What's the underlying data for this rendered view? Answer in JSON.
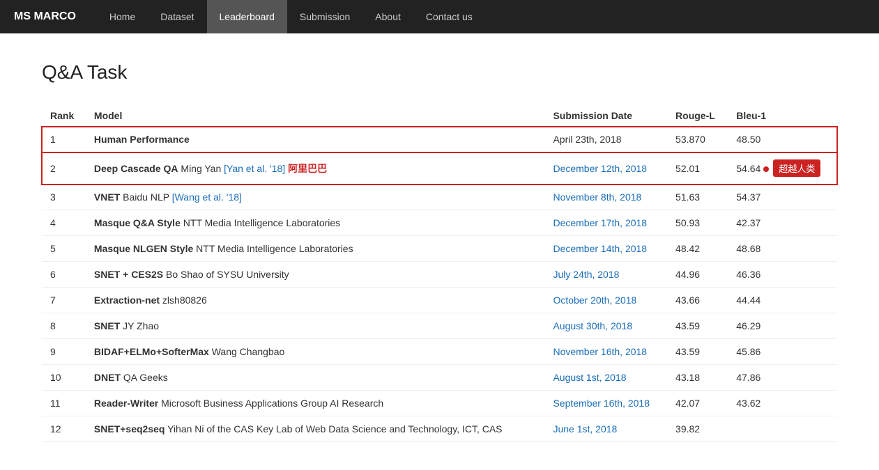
{
  "brand": "MS MARCO",
  "nav": {
    "items": [
      {
        "label": "Home",
        "active": false
      },
      {
        "label": "Dataset",
        "active": false
      },
      {
        "label": "Leaderboard",
        "active": true
      },
      {
        "label": "Submission",
        "active": false
      },
      {
        "label": "About",
        "active": false
      },
      {
        "label": "Contact us",
        "active": false
      }
    ]
  },
  "page_title": "Q&A Task",
  "table": {
    "headers": [
      "Rank",
      "Model",
      "Submission Date",
      "Rouge-L",
      "Bleu-1"
    ],
    "rows": [
      {
        "rank": "1",
        "model_bold": "Human Performance",
        "model_rest": "",
        "date": "April 23th, 2018",
        "date_link": false,
        "rouge_l": "53.870",
        "bleu_1": "48.50",
        "highlight": true,
        "badge": false,
        "red_dot": false
      },
      {
        "rank": "2",
        "model_bold": "Deep Cascade QA",
        "model_rest": "Ming Yan",
        "model_link1_text": "[Yan et al. '18]",
        "model_link1_href": "#",
        "model_chinese": "阿里巴巴",
        "date": "December 12th, 2018",
        "date_link": true,
        "rouge_l": "52.01",
        "bleu_1": "54.64",
        "highlight": true,
        "badge": true,
        "badge_text": "超越人类",
        "red_dot": true
      },
      {
        "rank": "3",
        "model_bold": "VNET",
        "model_rest": "Baidu NLP",
        "model_link1_text": "[Wang et al. '18]",
        "model_link1_href": "#",
        "date": "November 8th, 2018",
        "date_link": true,
        "rouge_l": "51.63",
        "bleu_1": "54.37",
        "highlight": false,
        "badge": false
      },
      {
        "rank": "4",
        "model_bold": "Masque Q&A Style",
        "model_rest": "NTT Media Intelligence Laboratories",
        "date": "December 17th, 2018",
        "date_link": true,
        "rouge_l": "50.93",
        "bleu_1": "42.37",
        "highlight": false,
        "badge": false
      },
      {
        "rank": "5",
        "model_bold": "Masque NLGEN Style",
        "model_rest": "NTT Media Intelligence Laboratories",
        "date": "December 14th, 2018",
        "date_link": true,
        "rouge_l": "48.42",
        "bleu_1": "48.68",
        "highlight": false,
        "badge": false
      },
      {
        "rank": "6",
        "model_bold": "SNET + CES2S",
        "model_rest": "Bo Shao of SYSU University",
        "date": "July 24th, 2018",
        "date_link": true,
        "rouge_l": "44.96",
        "bleu_1": "46.36",
        "highlight": false,
        "badge": false
      },
      {
        "rank": "7",
        "model_bold": "Extraction-net",
        "model_rest": "zlsh80826",
        "date": "October 20th, 2018",
        "date_link": true,
        "rouge_l": "43.66",
        "bleu_1": "44.44",
        "highlight": false,
        "badge": false
      },
      {
        "rank": "8",
        "model_bold": "SNET",
        "model_rest": "JY Zhao",
        "date": "August 30th, 2018",
        "date_link": true,
        "rouge_l": "43.59",
        "bleu_1": "46.29",
        "highlight": false,
        "badge": false
      },
      {
        "rank": "9",
        "model_bold": "BIDAF+ELMo+SofterMax",
        "model_rest": "Wang Changbao",
        "date": "November 16th, 2018",
        "date_link": true,
        "rouge_l": "43.59",
        "bleu_1": "45.86",
        "highlight": false,
        "badge": false
      },
      {
        "rank": "10",
        "model_bold": "DNET",
        "model_rest": "QA Geeks",
        "date": "August 1st, 2018",
        "date_link": true,
        "rouge_l": "43.18",
        "bleu_1": "47.86",
        "highlight": false,
        "badge": false
      },
      {
        "rank": "11",
        "model_bold": "Reader-Writer",
        "model_rest": "Microsoft Business Applications Group AI Research",
        "date": "September 16th, 2018",
        "date_link": true,
        "rouge_l": "42.07",
        "bleu_1": "43.62",
        "highlight": false,
        "badge": false
      },
      {
        "rank": "12",
        "model_bold": "SNET+seq2seq",
        "model_rest": "Yihan Ni of the CAS Key Lab of Web Data Science and Technology, ICT, CAS",
        "date": "June 1st, 2018",
        "date_link": true,
        "rouge_l": "39.82",
        "bleu_1": "",
        "highlight": false,
        "badge": false
      }
    ]
  }
}
